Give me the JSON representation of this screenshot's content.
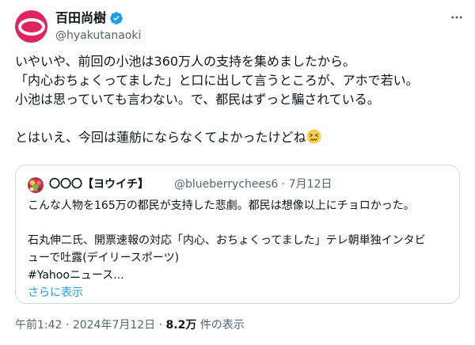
{
  "author": {
    "display_name": "百田尚樹",
    "handle": "@hyakutanaoki"
  },
  "tweet": {
    "lines": [
      "いやいや、前回の小池は360万人の支持を集めましたから。",
      "「内心おちょくってました」と口に出して言うところが、アホで若い。",
      "小池は思っていても言わない。で、都民はずっと騙されている。",
      "",
      "とはいえ、今回は蓮舫にならなくてよかったけどね"
    ],
    "emoji_icon": "confounded-face-emoji"
  },
  "quote": {
    "display_name": "〇〇〇【ヨウイチ】",
    "handle": "@blueberrychees6",
    "separator": "·",
    "date": "7月12日",
    "lines": [
      "こんな人物を165万の都民が支持した悲劇。都民は想像以上にチョロかった。",
      "",
      "石丸伸二氏、開票速報の対応「内心、おちょくってました」テレ朝単独インタビ",
      "ューで吐露(デイリースポーツ)",
      "#Yahooニュース..."
    ],
    "show_more": "さらに表示"
  },
  "footer": {
    "time": "午前1:42",
    "separator1": "·",
    "date": "2024年7月12日",
    "separator2": "·",
    "views_count": "8.2万",
    "views_label": "件の表示"
  },
  "colors": {
    "avatar": "#e0245e",
    "verified": "#1d9bf0",
    "link": "#1d9bf0",
    "secondary_text": "#536471",
    "border": "#cfd9de"
  },
  "icons": {
    "more": "more-horizontal-icon",
    "verified": "verified-badge-icon"
  }
}
